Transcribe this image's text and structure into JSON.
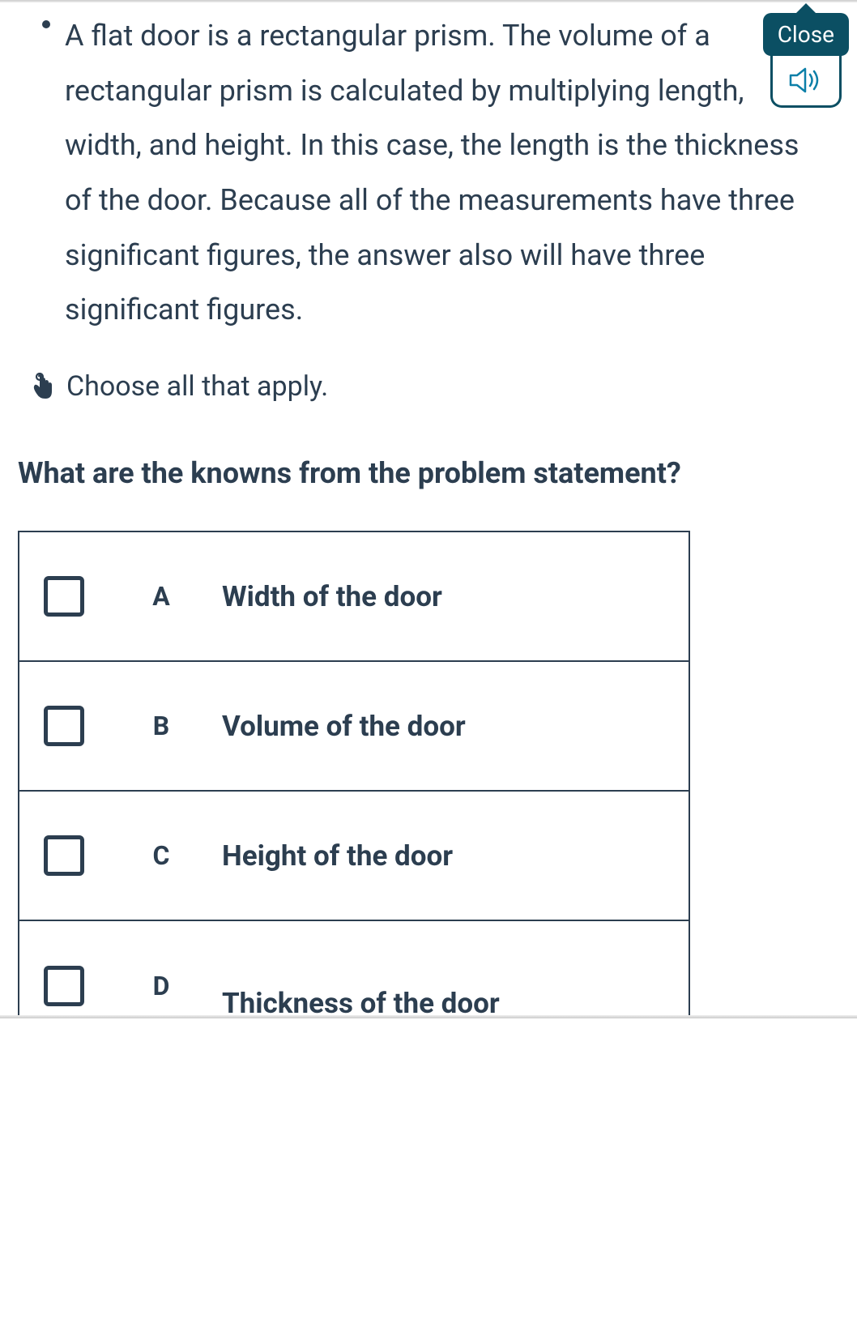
{
  "tooltip": {
    "close_label": "Close"
  },
  "bullet": {
    "text": "A flat door is a rectangular prism. The volume of a rectangular prism is calculated by multiplying length, width, and height. In this case, the length is the thickness of the door. Because all of the measurements have three significant figures, the answer also will have three significant figures."
  },
  "instruction": "Choose all that apply.",
  "question": "What are the knowns from the problem statement?",
  "options": [
    {
      "letter": "A",
      "text": "Width of the door"
    },
    {
      "letter": "B",
      "text": "Volume of the door"
    },
    {
      "letter": "C",
      "text": "Height of the door"
    },
    {
      "letter": "D",
      "text": "Thickness of the door"
    }
  ]
}
